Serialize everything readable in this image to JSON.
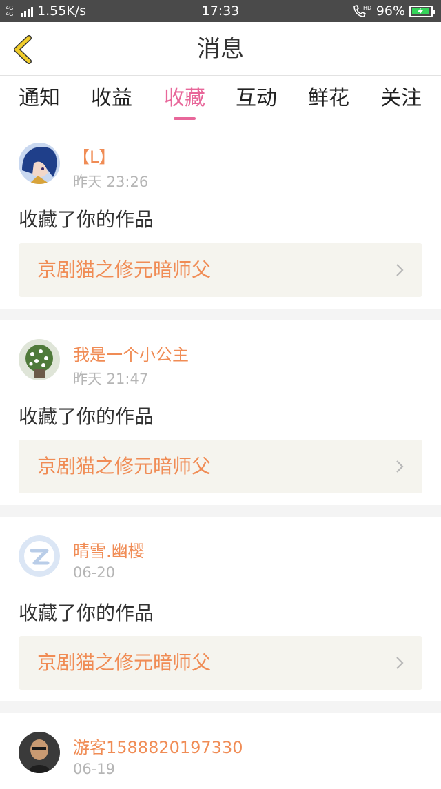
{
  "status_bar": {
    "network": "4G 4G",
    "speed": "1.55K/s",
    "time": "17:33",
    "call_badge": "HD",
    "battery": "96%",
    "battery_level": 0.96,
    "battery_color": "#35d35a"
  },
  "navbar": {
    "title": "消息",
    "back_icon": "chevron-left-icon",
    "back_color": "#f0cc2a"
  },
  "tabs": [
    {
      "label": "通知",
      "active": false
    },
    {
      "label": "收益",
      "active": false
    },
    {
      "label": "收藏",
      "active": true
    },
    {
      "label": "互动",
      "active": false
    },
    {
      "label": "鲜花",
      "active": false
    },
    {
      "label": "关注",
      "active": false
    }
  ],
  "accent": "#e8679a",
  "name_color": "#f08c55",
  "notifications": [
    {
      "user": "【L】",
      "time": "昨天 23:26",
      "action": "收藏了你的作品",
      "work": "京剧猫之修元暗师父"
    },
    {
      "user": "我是一个小公主",
      "time": "昨天 21:47",
      "action": "收藏了你的作品",
      "work": "京剧猫之修元暗师父"
    },
    {
      "user": "晴雪.幽樱",
      "time": "06-20",
      "action": "收藏了你的作品",
      "work": "京剧猫之修元暗师父"
    },
    {
      "user": "游客1588820197330",
      "time": "06-19",
      "action": "",
      "work": ""
    }
  ]
}
